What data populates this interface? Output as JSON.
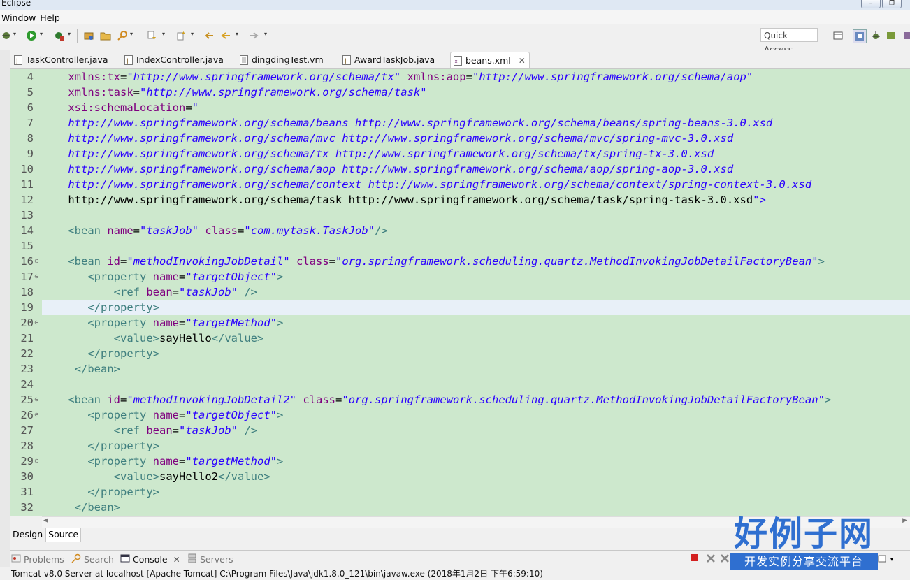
{
  "window": {
    "title": "Eclipse"
  },
  "menubar": {
    "items": [
      "Window",
      "Help"
    ]
  },
  "toolbar": {
    "quick_access_placeholder": "Quick Access"
  },
  "editor_tabs": [
    {
      "label": "TaskController.java",
      "icon": "java-file-icon",
      "active": false
    },
    {
      "label": "IndexController.java",
      "icon": "java-file-icon",
      "active": false
    },
    {
      "label": "dingdingTest.vm",
      "icon": "text-file-icon",
      "active": false
    },
    {
      "label": "AwardTaskJob.java",
      "icon": "java-file-icon",
      "active": false
    },
    {
      "label": "beans.xml",
      "icon": "xml-file-icon",
      "active": true
    }
  ],
  "editor": {
    "current_line": 19,
    "lines": [
      {
        "num": "4",
        "text": "    xmlns:tx=\"http://www.springframework.org/schema/tx\" xmlns:aop=\"http://www.springframework.org/schema/aop\""
      },
      {
        "num": "5",
        "text": "    xmlns:task=\"http://www.springframework.org/schema/task\""
      },
      {
        "num": "6",
        "text": "    xsi:schemaLocation=\""
      },
      {
        "num": "7",
        "text": "    http://www.springframework.org/schema/beans http://www.springframework.org/schema/beans/spring-beans-3.0.xsd"
      },
      {
        "num": "8",
        "text": "    http://www.springframework.org/schema/mvc http://www.springframework.org/schema/mvc/spring-mvc-3.0.xsd"
      },
      {
        "num": "9",
        "text": "    http://www.springframework.org/schema/tx http://www.springframework.org/schema/tx/spring-tx-3.0.xsd"
      },
      {
        "num": "10",
        "text": "    http://www.springframework.org/schema/aop http://www.springframework.org/schema/aop/spring-aop-3.0.xsd"
      },
      {
        "num": "11",
        "text": "    http://www.springframework.org/schema/context http://www.springframework.org/schema/context/spring-context-3.0.xsd"
      },
      {
        "num": "12",
        "text": "    http://www.springframework.org/schema/task http://www.springframework.org/schema/task/spring-task-3.0.xsd\">"
      },
      {
        "num": "13",
        "text": ""
      },
      {
        "num": "14",
        "text": "    <bean name=\"taskJob\" class=\"com.mytask.TaskJob\"/>"
      },
      {
        "num": "15",
        "text": ""
      },
      {
        "num": "16",
        "text": "    <bean id=\"methodInvokingJobDetail\" class=\"org.springframework.scheduling.quartz.MethodInvokingJobDetailFactoryBean\">"
      },
      {
        "num": "17",
        "text": "       <property name=\"targetObject\">"
      },
      {
        "num": "18",
        "text": "           <ref bean=\"taskJob\" />"
      },
      {
        "num": "19",
        "text": "       </property>"
      },
      {
        "num": "20",
        "text": "       <property name=\"targetMethod\">"
      },
      {
        "num": "21",
        "text": "           <value>sayHello</value>"
      },
      {
        "num": "22",
        "text": "       </property>"
      },
      {
        "num": "23",
        "text": "     </bean>"
      },
      {
        "num": "24",
        "text": ""
      },
      {
        "num": "25",
        "text": "    <bean id=\"methodInvokingJobDetail2\" class=\"org.springframework.scheduling.quartz.MethodInvokingJobDetailFactoryBean\">"
      },
      {
        "num": "26",
        "text": "       <property name=\"targetObject\">"
      },
      {
        "num": "27",
        "text": "           <ref bean=\"taskJob\" />"
      },
      {
        "num": "28",
        "text": "       </property>"
      },
      {
        "num": "29",
        "text": "       <property name=\"targetMethod\">"
      },
      {
        "num": "30",
        "text": "           <value>sayHello2</value>"
      },
      {
        "num": "31",
        "text": "       </property>"
      },
      {
        "num": "32",
        "text": "     </bean>"
      }
    ],
    "fold_lines": [
      "16",
      "17",
      "20",
      "25",
      "26",
      "29"
    ],
    "colors": {
      "background": "#cde8cd",
      "tag": "#3f7f7f",
      "attr_name": "#7f007f",
      "attr_value": "#2a00ff",
      "current_line": "#e8f0f8"
    }
  },
  "bottom_tabs": {
    "design": "Design",
    "source": "Source",
    "active": "Source"
  },
  "console": {
    "tabs": [
      {
        "label": "Problems",
        "icon": "problems-icon",
        "active": false
      },
      {
        "label": "Search",
        "icon": "search-icon",
        "active": false
      },
      {
        "label": "Console",
        "icon": "console-icon",
        "active": true
      },
      {
        "label": "Servers",
        "icon": "servers-icon",
        "active": false
      }
    ],
    "status": "Tomcat v8.0 Server at localhost [Apache Tomcat] C:\\Program Files\\Java\\jdk1.8.0_121\\bin\\javaw.exe (2018年1月2日 下午6:59:10)"
  },
  "watermark": {
    "logo": "好例子网",
    "tagline": "开发实例分享交流平台"
  }
}
